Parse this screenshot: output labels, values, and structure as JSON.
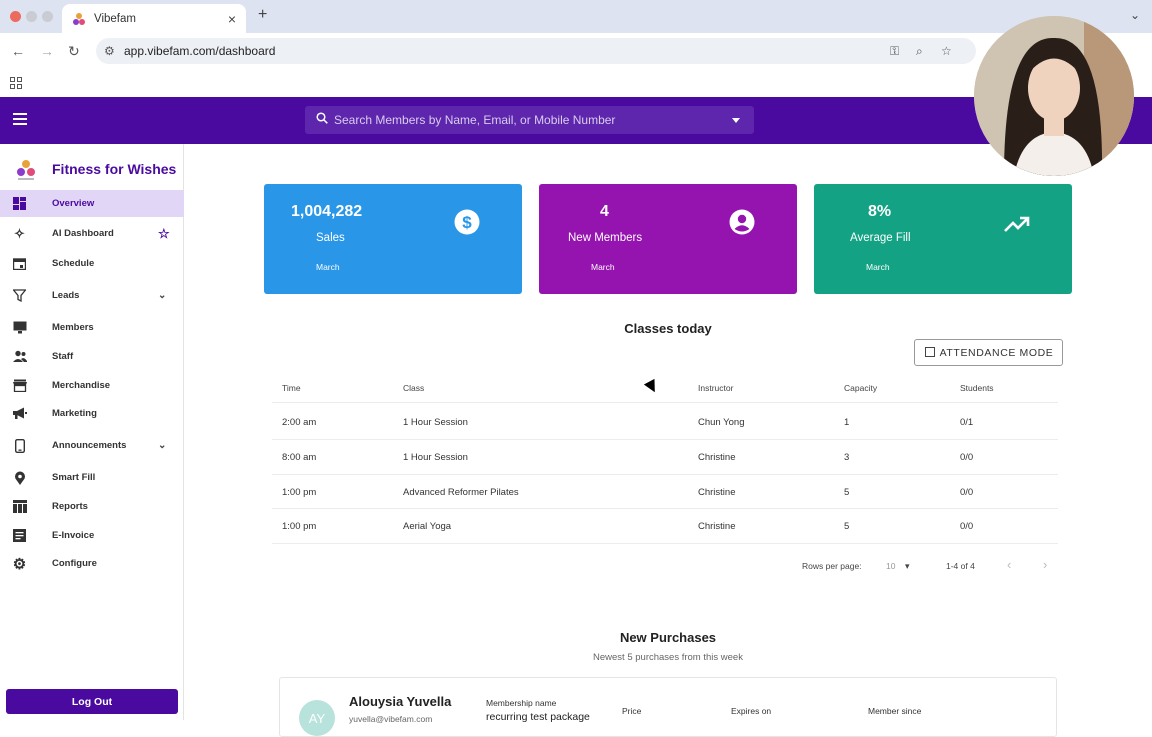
{
  "browser": {
    "tab_title": "Vibefam",
    "url": "app.vibefam.com/dashboard"
  },
  "colors": {
    "brand": "#4a0aa0",
    "card_sales": "#2996e8",
    "card_members": "#9513af",
    "card_fill": "#13a384"
  },
  "search": {
    "placeholder": "Search Members by Name, Email, or Mobile Number"
  },
  "sidebar": {
    "brand": "Fitness for Wishes",
    "items": [
      {
        "label": "Overview",
        "icon": "dashboard-icon"
      },
      {
        "label": "AI Dashboard",
        "icon": "sparkle-icon"
      },
      {
        "label": "Schedule",
        "icon": "calendar-icon"
      },
      {
        "label": "Leads",
        "icon": "filter-icon"
      },
      {
        "label": "Members",
        "icon": "monitor-icon"
      },
      {
        "label": "Staff",
        "icon": "people-icon"
      },
      {
        "label": "Merchandise",
        "icon": "store-icon"
      },
      {
        "label": "Marketing",
        "icon": "megaphone-icon"
      },
      {
        "label": "Announcements",
        "icon": "phone-icon"
      },
      {
        "label": "Smart Fill",
        "icon": "location-icon"
      },
      {
        "label": "Reports",
        "icon": "table-icon"
      },
      {
        "label": "E-Invoice",
        "icon": "document-icon"
      },
      {
        "label": "Configure",
        "icon": "gear-icon"
      }
    ],
    "logout": "Log Out"
  },
  "stats": [
    {
      "value": "1,004,282",
      "label": "Sales",
      "period": "March",
      "icon": "dollar-icon"
    },
    {
      "value": "4",
      "label": "New Members",
      "period": "March",
      "icon": "account-icon"
    },
    {
      "value": "8%",
      "label": "Average Fill",
      "period": "March",
      "icon": "trending-up-icon"
    }
  ],
  "classes": {
    "title": "Classes today",
    "attendance_button": "ATTENDANCE MODE",
    "headers": [
      "Time",
      "Class",
      "Instructor",
      "Capacity",
      "Students"
    ],
    "rows": [
      [
        "2:00 am",
        "1 Hour Session",
        "Chun Yong",
        "1",
        "0/1"
      ],
      [
        "8:00 am",
        "1 Hour Session",
        "Christine",
        "3",
        "0/0"
      ],
      [
        "1:00 pm",
        "Advanced Reformer Pilates",
        "Christine",
        "5",
        "0/0"
      ],
      [
        "1:00 pm",
        "Aerial Yoga",
        "Christine",
        "5",
        "0/0"
      ]
    ],
    "rows_per_page_label": "Rows per page:",
    "rows_per_page": "10",
    "range": "1-4 of 4"
  },
  "purchases": {
    "title": "New Purchases",
    "subtitle": "Newest 5 purchases from this week",
    "first": {
      "initials": "AY",
      "name": "Alouysia Yuvella",
      "email": "yuvella@vibefam.com",
      "membership_label": "Membership name",
      "membership_value": "recurring test package",
      "price_label": "Price",
      "expires_label": "Expires on",
      "member_since_label": "Member since"
    }
  }
}
